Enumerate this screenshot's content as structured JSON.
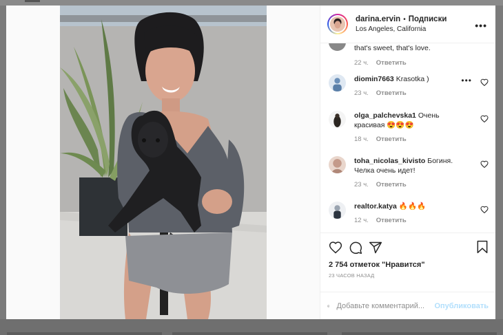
{
  "post": {
    "username": "darina.ervin",
    "separator": "•",
    "follow_label": "Подписки",
    "location": "Los Angeles, California",
    "more_icon": "more-horizontal-icon"
  },
  "comments": {
    "partial": {
      "text": "that's sweet, that's love.",
      "time": "22 ч.",
      "reply": "Ответить"
    },
    "items": [
      {
        "user": "diomin7663",
        "text": "Krasotka )",
        "time": "23 ч.",
        "reply": "Ответить",
        "avatar_color": "#6b8fb8"
      },
      {
        "user": "olga_palchevska1",
        "text": "Очень красивая 😍😍😍",
        "time": "18 ч.",
        "reply": "Ответить",
        "avatar_color": "#2a2520"
      },
      {
        "user": "toha_nicolas_kivisto",
        "text": "Богиня. Челка очень идет!",
        "time": "23 ч.",
        "reply": "Ответить",
        "avatar_color": "#c49a8a"
      },
      {
        "user": "realtor.katya",
        "text": "🔥🔥🔥",
        "time": "12 ч.",
        "reply": "Ответить",
        "avatar_color": "#9aa4b0"
      }
    ]
  },
  "actions": {
    "like_icon": "heart-icon",
    "comment_icon": "comment-icon",
    "share_icon": "share-icon",
    "save_icon": "bookmark-icon",
    "likes_text": "2 754 отметок \"Нравится\"",
    "time_ago": "23 ЧАСОВ НАЗАД"
  },
  "add_comment": {
    "emoji_icon": "emoji-icon",
    "placeholder": "Добавьте комментарий...",
    "publish_label": "Опубликовать"
  },
  "colors": {
    "link_disabled": "#b2dffc",
    "secondary_text": "#8e8e8e",
    "border": "#efefef"
  }
}
